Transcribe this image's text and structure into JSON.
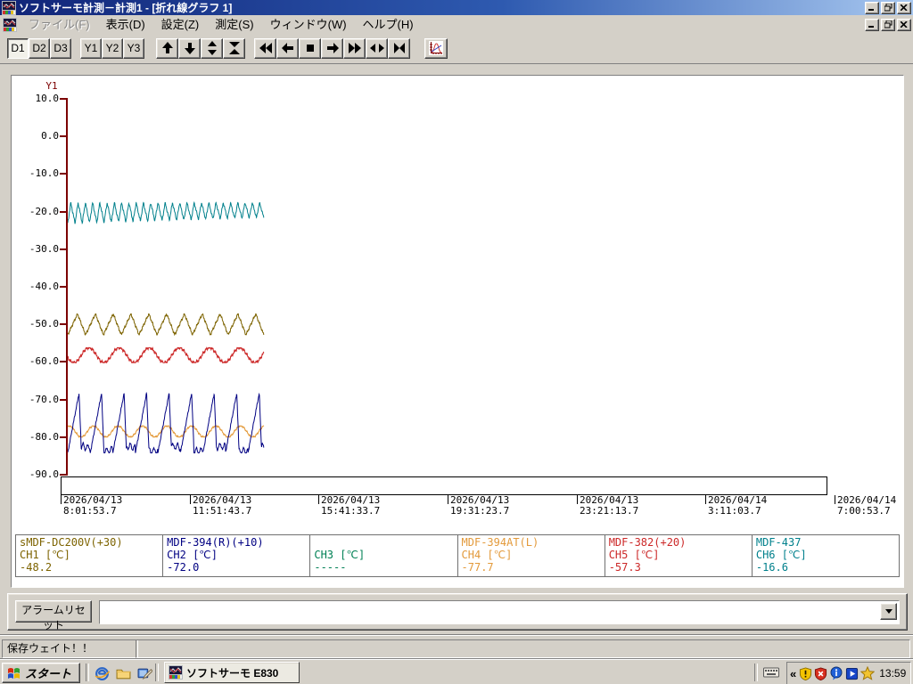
{
  "window": {
    "title": "ソフトサーモ計測－計測1 - [折れ線グラフ 1]",
    "controls": [
      "minimize",
      "restore",
      "close"
    ]
  },
  "menu": {
    "items": [
      {
        "label": "ファイル(F)",
        "enabled": false
      },
      {
        "label": "表示(D)",
        "enabled": true
      },
      {
        "label": "設定(Z)",
        "enabled": true
      },
      {
        "label": "測定(S)",
        "enabled": true
      },
      {
        "label": "ウィンドウ(W)",
        "enabled": true
      },
      {
        "label": "ヘルプ(H)",
        "enabled": true
      }
    ]
  },
  "toolbar": {
    "data_buttons": [
      {
        "label": "D1",
        "pressed": true
      },
      {
        "label": "D2",
        "pressed": false
      },
      {
        "label": "D3",
        "pressed": false
      }
    ],
    "y_buttons": [
      {
        "label": "Y1",
        "pressed": false
      },
      {
        "label": "Y2",
        "pressed": false
      },
      {
        "label": "Y3",
        "pressed": false
      }
    ],
    "nav_icons": [
      "arrow-up",
      "arrow-down",
      "expand-vertical",
      "compress-vertical"
    ],
    "transport_icons": [
      "fast-rewind",
      "step-left",
      "stop",
      "step-right",
      "fast-forward",
      "expand-horizontal",
      "compress-horizontal"
    ],
    "graph_icon": "graph-settings"
  },
  "chart_data": {
    "type": "line",
    "title": "折れ線グラフ 1",
    "y_axis": {
      "label": "Y1",
      "max": 10.0,
      "min": -90.0,
      "tick_interval": 10.0,
      "tick_labels": [
        "10.0",
        "0.0",
        "-10.0",
        "-20.0",
        "-30.0",
        "-40.0",
        "-50.0",
        "-60.0",
        "-70.0",
        "-80.0",
        "-90.0"
      ]
    },
    "x_axis": {
      "tick_labels": [
        {
          "date": "2026/04/13",
          "time": "8:01:53.7"
        },
        {
          "date": "2026/04/13",
          "time": "11:51:43.7"
        },
        {
          "date": "2026/04/13",
          "time": "15:41:33.7"
        },
        {
          "date": "2026/04/13",
          "time": "19:31:23.7"
        },
        {
          "date": "2026/04/13",
          "time": "23:21:13.7"
        },
        {
          "date": "2026/04/14",
          "time": "3:11:03.7"
        },
        {
          "date": "2026/04/14",
          "time": "7:00:53.7"
        }
      ]
    },
    "time_span_fraction": 0.24,
    "series": [
      {
        "channel": "CH1",
        "name": "sMDF-DC200V(+30)",
        "label": "CH1 [℃]",
        "value": "-48.2",
        "color": "#7d6300",
        "waveform": {
          "shape": "triangle",
          "cycles": 11,
          "rise": 0.55,
          "y_max": -47.2,
          "y_min": -52.8,
          "jitter": 0.07
        }
      },
      {
        "channel": "CH2",
        "name": "MDF-394(R)(+10)",
        "label": "CH2 [℃]",
        "value": "-72.0",
        "color": "#000082",
        "waveform": {
          "shape": "ramp-drop",
          "cycles": 8.7,
          "y_max": -68.3,
          "y_min": -84.2,
          "jitter": 0.02
        }
      },
      {
        "channel": "CH3",
        "name": "",
        "label": "CH3 [℃]",
        "value": "-----",
        "color": "#008055",
        "waveform": null
      },
      {
        "channel": "CH4",
        "name": "MDF-394AT(L)",
        "label": "CH4 [℃]",
        "value": "-77.7",
        "color": "#e39a3b",
        "waveform": {
          "shape": "sine",
          "cycles": 8,
          "phase": 0.2,
          "y_max": -77.0,
          "y_min": -80.0,
          "jitter": 0.1
        }
      },
      {
        "channel": "CH5",
        "name": "MDF-382(+20)",
        "label": "CH5 [℃]",
        "value": "-57.3",
        "color": "#cc2828",
        "waveform": {
          "shape": "sine",
          "cycles": 6.5,
          "phase": 0.55,
          "y_max": -56.2,
          "y_min": -60.2,
          "jitter": 0.12
        }
      },
      {
        "channel": "CH6",
        "name": "MDF-437",
        "label": "CH6 [℃]",
        "value": "-16.6",
        "color": "#00808c",
        "waveform": {
          "shape": "triangle",
          "cycles": 27,
          "rise": 0.42,
          "y_max": -17.6,
          "y_min": -23.2,
          "y_min_end": -21.6,
          "jitter": 0.08
        }
      }
    ]
  },
  "alarm": {
    "button_label": "アラームリセット",
    "combo_value": ""
  },
  "status": {
    "left_text": "保存ウェイト！！"
  },
  "taskbar": {
    "start_label": "スタート",
    "quick_launch": [
      "ie-icon",
      "folder-icon",
      "show-desktop-icon"
    ],
    "task": {
      "label": "ソフトサーモ  E830"
    },
    "tray": {
      "chevron": "«",
      "icons": [
        "security-warning-shield-icon",
        "security-alert-shield-icon",
        "info-balloon-icon",
        "media-player-icon",
        "star-icon"
      ],
      "clock": "13:59"
    }
  }
}
